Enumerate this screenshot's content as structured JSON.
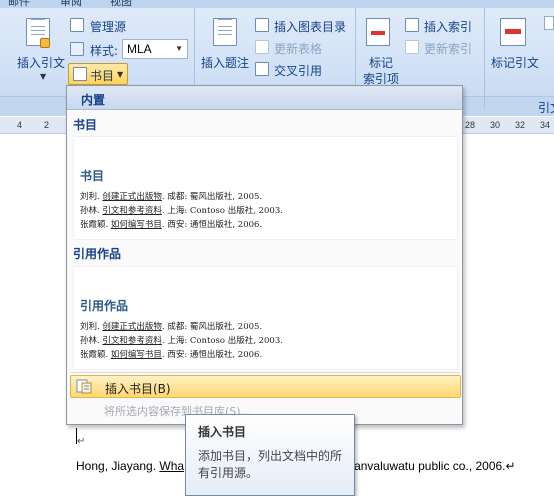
{
  "ribbon": {
    "tabs_partial": [
      "邮件",
      "审阅",
      "视图"
    ],
    "citations": {
      "insert_citation": "插入引文",
      "manage_sources": "管理源",
      "style_label": "样式:",
      "style_value": "MLA",
      "bibliography": "书目"
    },
    "captions": {
      "insert_caption": "插入题注",
      "insert_table_of_figures": "插入图表目录",
      "update_table": "更新表格",
      "cross_reference": "交叉引用"
    },
    "index": {
      "mark_entry_line1": "标记",
      "mark_entry_line2": "索引项",
      "insert_index": "插入索引",
      "update_index": "更新索引"
    },
    "toa": {
      "mark_citation": "标记引文",
      "group_label_partial": "引文"
    }
  },
  "ruler": {
    "ticks_left": [
      "4",
      "2"
    ],
    "ticks_right": [
      "28",
      "30",
      "32",
      "34"
    ]
  },
  "dropdown": {
    "header": "内置",
    "sections": [
      {
        "title": "书目",
        "preview_title": "书目",
        "entries": [
          {
            "pre": "刘利. ",
            "link": "创建正式出版物",
            "post": ". 成都: 蜀风出版社, 2005."
          },
          {
            "pre": "孙林. ",
            "link": "引文和参考资料",
            "post": ". 上海: Contoso 出版社, 2003."
          },
          {
            "pre": "张霞颖. ",
            "link": "如何编写书目",
            "post": ". 西安: 通恒出版社, 2006."
          }
        ]
      },
      {
        "title": "引用作品",
        "preview_title": "引用作品",
        "entries": [
          {
            "pre": "刘利. ",
            "link": "创建正式出版物",
            "post": ". 成都: 蜀风出版社, 2005."
          },
          {
            "pre": "孙林. ",
            "link": "引文和参考资料",
            "post": ". 上海: Contoso 出版社, 2003."
          },
          {
            "pre": "张霞颖. ",
            "link": "如何编写书目",
            "post": ". 西安: 通恒出版社, 2006."
          }
        ]
      }
    ],
    "insert_bibliography": "插入书目(B)",
    "save_selection": "将所选内容保存到书目库(S)..."
  },
  "tooltip": {
    "title": "插入书目",
    "body": "添加书目，列出文档中的所有引用源。"
  },
  "document": {
    "ref_pre": "Hong, Jiayang. ",
    "ref_link": "Wha",
    "ref_post": "anvaluwatu public co., 2006.↵",
    "paragraph_mark": "↵"
  },
  "colors": {
    "ribbon_bg": "#d2e2f6",
    "highlight": "#ffd770",
    "accent_text": "#15428b"
  }
}
